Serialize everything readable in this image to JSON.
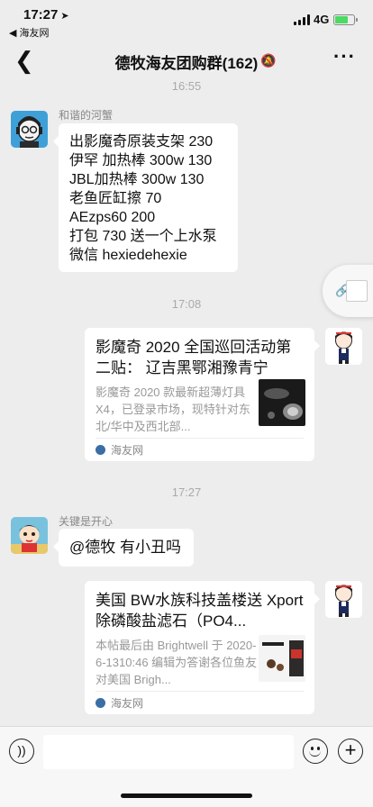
{
  "status_bar": {
    "time": "17:27",
    "back_app": "◀ 海友网",
    "network": "4G"
  },
  "nav": {
    "title": "德牧海友团购群(162)"
  },
  "messages": {
    "ts1": "16:55",
    "msg1": {
      "sender": "和谐的河蟹",
      "lines": [
        "出影魔奇原装支架 230",
        "伊罕 加热棒 300w 130",
        "JBL加热棒 300w 130",
        "老鱼匠缸擦 70",
        "AEzps60 200",
        "打包 730 送一个上水泵",
        "微信 hexiedehexie"
      ]
    },
    "ts2": "17:08",
    "card1": {
      "title": "影魔奇 2020 全国巡回活动第二贴： 辽吉黑鄂湘豫青宁",
      "desc": "影魔奇 2020 款最新超薄灯具 X4，已登录市场，现特针对东北/华中及西北部...",
      "source": "海友网"
    },
    "ts3": "17:27",
    "msg2": {
      "sender": "关键是开心",
      "text": "@德牧 有小丑吗"
    },
    "card2": {
      "title": "美国 BW水族科技盖楼送 Xport除磷酸盐滤石（PO4...",
      "desc": "本帖最后由 Brightwell 于 2020-6-1310:46 编辑为答谢各位鱼友对美国 Brigh...",
      "source": "海友网"
    }
  },
  "input_bar": {
    "placeholder": ""
  }
}
